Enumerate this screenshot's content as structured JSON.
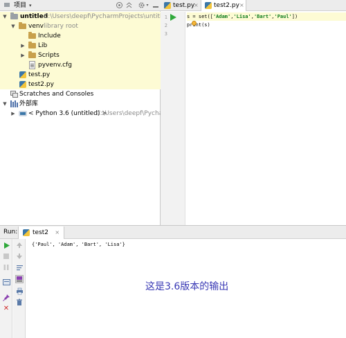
{
  "project_panel": {
    "header_title": "项目",
    "header_title_arrow": "▾",
    "header_icons": [
      "settings-target-icon",
      "collapse-all-icon",
      "gear-icon",
      "hide-icon"
    ],
    "tree": [
      {
        "name": "tree-root-untitled",
        "label": "untitled",
        "sub": "C:\\Users\\deepf\\PycharmProjects\\untitled",
        "icon": "folder-icon",
        "expanded": true
      },
      {
        "name": "tree-venv",
        "label": "venv",
        "sub": "library root",
        "icon": "folder-icon",
        "expanded": true
      },
      {
        "name": "tree-include",
        "label": "Include",
        "icon": "folder-icon"
      },
      {
        "name": "tree-lib",
        "label": "Lib",
        "icon": "folder-icon",
        "expanded": false
      },
      {
        "name": "tree-scripts",
        "label": "Scripts",
        "icon": "folder-icon",
        "expanded": false
      },
      {
        "name": "tree-pyvenv-cfg",
        "label": "pyvenv.cfg",
        "icon": "config-file-icon"
      },
      {
        "name": "tree-test-py",
        "label": "test.py",
        "icon": "python-file-icon"
      },
      {
        "name": "tree-test2-py",
        "label": "test2.py",
        "icon": "python-file-icon"
      },
      {
        "name": "tree-scratches",
        "label": "Scratches and Consoles",
        "icon": "scratches-icon"
      },
      {
        "name": "tree-external-libs",
        "label": "外部库",
        "icon": "libraries-icon",
        "expanded": true
      },
      {
        "name": "tree-python36",
        "label": "< Python 3.6 (untitled) >",
        "sub": "C:\\Users\\deepf\\Pycharm",
        "icon": "python-sdk-icon",
        "expanded": false
      }
    ]
  },
  "editor": {
    "tabs": [
      {
        "label": "test.py",
        "close": "×",
        "active": false
      },
      {
        "label": "test2.py",
        "close": "×",
        "active": true
      }
    ],
    "line_numbers": [
      "1",
      "2",
      "3"
    ],
    "code": {
      "line1_prefix": "s = set([",
      "s1": "'Adam'",
      "s2": "'Lisa'",
      "s3": "'Bart'",
      "s4": "'Paul'",
      "comma": ",",
      "line1_suffix": "])",
      "line2": "print(s)",
      "line3": ""
    }
  },
  "run_panel": {
    "label": "Run:",
    "tab_label": "test2",
    "tab_close": "×",
    "console_output": "{'Paul', 'Adam', 'Bart', 'Lisa'}",
    "annotation": "这是3.6版本的输出",
    "toolbar_left": [
      "rerun-icon",
      "stop-icon",
      "pause-icon",
      "dump-threads-icon",
      "pin-icon",
      "close-icon"
    ],
    "toolbar_right": [
      "scroll-up-icon",
      "scroll-down-icon",
      "soft-wrap-icon",
      "scroll-to-end-icon",
      "print-icon",
      "clear-all-icon"
    ]
  }
}
